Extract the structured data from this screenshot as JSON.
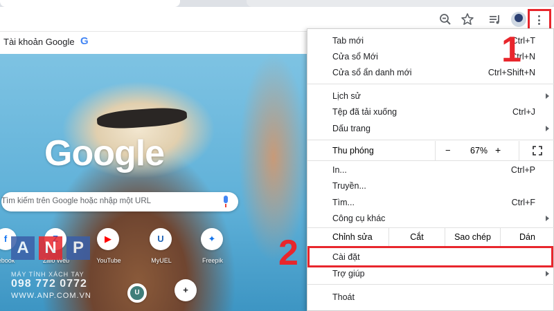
{
  "toolbar": {
    "icons": [
      "zoom-icon",
      "star-icon",
      "media-icon",
      "avatar",
      "more-vert-icon"
    ]
  },
  "bookmarks": {
    "account_label": "Tài khoản Google",
    "google_glyph": "G"
  },
  "newtab": {
    "logo_text": "Google",
    "search_placeholder": "Tìm kiếm trên Google hoặc nhập một URL",
    "shortcuts": [
      {
        "label": "ebook",
        "glyph": "f",
        "color": "#1877f2"
      },
      {
        "label": "Zalo Web",
        "glyph": "Z",
        "color": "#0068ff"
      },
      {
        "label": "YouTube",
        "glyph": "▶",
        "color": "#ff0000"
      },
      {
        "label": "MyUEL",
        "glyph": "U",
        "color": "#1e63b5"
      },
      {
        "label": "Freepik",
        "glyph": "✦",
        "color": "#1273eb"
      }
    ],
    "shortcuts_row2": [
      {
        "label": "",
        "glyph": "U",
        "color": "#1e63b5"
      },
      {
        "label": "",
        "glyph": "+",
        "color": "#202124"
      }
    ]
  },
  "watermark": {
    "letters": [
      "A",
      "N",
      "P"
    ],
    "subtitle": "MÁY TÍNH XÁCH TAY",
    "phone": "098 772 0772",
    "site": "WWW.ANP.COM.VN"
  },
  "menu": {
    "new_tab": {
      "label": "Tab mới",
      "shortcut": "Ctrl+T"
    },
    "new_window": {
      "label": "Cửa sổ Mới",
      "shortcut": "Ctrl+N"
    },
    "incognito": {
      "label": "Cửa sổ ẩn danh mới",
      "shortcut": "Ctrl+Shift+N"
    },
    "history": {
      "label": "Lịch sử"
    },
    "downloads": {
      "label": "Tệp đã tải xuống",
      "shortcut": "Ctrl+J"
    },
    "bookmarks": {
      "label": "Dấu trang"
    },
    "zoom": {
      "label": "Thu phóng",
      "minus": "−",
      "value": "67%",
      "plus": "+"
    },
    "print": {
      "label": "In...",
      "shortcut": "Ctrl+P"
    },
    "cast": {
      "label": "Truyền..."
    },
    "find": {
      "label": "Tìm...",
      "shortcut": "Ctrl+F"
    },
    "more_tools": {
      "label": "Công cụ khác"
    },
    "edit": {
      "label": "Chỉnh sửa",
      "cut": "Cắt",
      "copy": "Sao chép",
      "paste": "Dán"
    },
    "settings": {
      "label": "Cài đặt"
    },
    "help": {
      "label": "Trợ giúp"
    },
    "exit": {
      "label": "Thoát"
    }
  },
  "annotations": {
    "step1": "1",
    "step2": "2",
    "highlight_color": "#e8262c"
  }
}
